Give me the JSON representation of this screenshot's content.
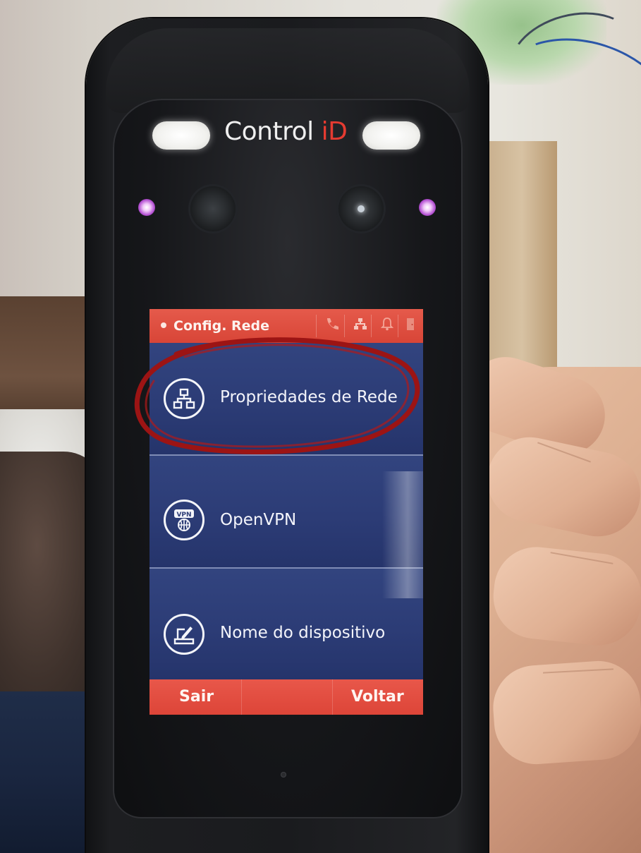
{
  "device": {
    "brand": {
      "text_main": "Control ",
      "text_accent": "iD",
      "accent_color": "#e53b31"
    }
  },
  "screen": {
    "status_bar": {
      "title": "Config. Rede",
      "color": "#d84537",
      "icons": [
        "phone-icon",
        "network-icon",
        "bell-icon",
        "door-icon"
      ]
    },
    "menu": {
      "items": [
        {
          "label": "Propriedades de Rede",
          "icon": "network-topology-icon"
        },
        {
          "label": "OpenVPN",
          "icon": "vpn-globe-icon"
        },
        {
          "label": "Nome do dispositivo",
          "icon": "edit-device-icon"
        }
      ],
      "background_color": "#2c3c76"
    },
    "bottom_bar": {
      "exit_label": "Sair",
      "back_label": "Voltar"
    }
  },
  "annotation": {
    "shape": "hand-drawn-ellipse",
    "color": "#9c1414",
    "highlights": "Propriedades de Rede"
  }
}
